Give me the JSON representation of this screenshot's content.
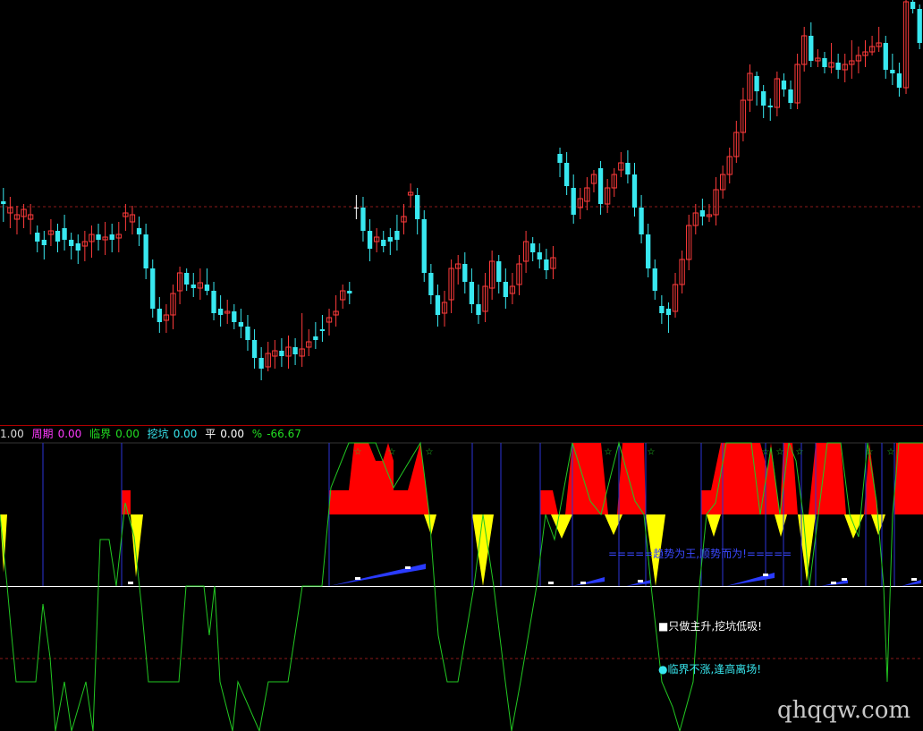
{
  "colors": {
    "up": "#ff3b3b",
    "down": "#38e8f0",
    "flat": "#ffffff",
    "grid": "#8b1a1a",
    "divider": "#b00000",
    "osc": "#22c822",
    "red": "#ff0000",
    "yellow": "#ffff00",
    "blue": "#2a3bff",
    "vline": "#2b34d8",
    "star": "#22c822"
  },
  "legend": {
    "first_value": "1.00",
    "period_label": "周期",
    "period_value": "0.00",
    "critical_label": "临界",
    "critical_value": "0.00",
    "dig_label": "挖坑",
    "dig_value": "0.00",
    "flat_label": "平",
    "flat_value": "0.00",
    "pct_label": "%",
    "pct_value": "-66.67"
  },
  "notes": {
    "trend_banner": "=====趋势为王,顺势而为!=====",
    "note_main": "只做主升,挖坑低吸!",
    "note_critical": "临界不涨,逢高离场!"
  },
  "watermark": "qhqqw.com",
  "candles": [
    [
      225,
      228,
      248,
      210
    ],
    [
      238,
      232,
      255,
      220
    ],
    [
      245,
      240,
      262,
      230
    ],
    [
      242,
      234,
      255,
      228
    ],
    [
      245,
      240,
      262,
      228
    ],
    [
      260,
      270,
      282,
      252
    ],
    [
      268,
      274,
      290,
      258
    ],
    [
      262,
      258,
      275,
      245
    ],
    [
      258,
      270,
      282,
      250
    ],
    [
      255,
      268,
      280,
      240
    ],
    [
      268,
      275,
      290,
      260
    ],
    [
      272,
      280,
      295,
      262
    ],
    [
      275,
      270,
      292,
      258
    ],
    [
      270,
      262,
      288,
      252
    ],
    [
      262,
      268,
      280,
      250
    ],
    [
      268,
      265,
      285,
      248
    ],
    [
      262,
      268,
      282,
      250
    ],
    [
      266,
      262,
      282,
      248
    ],
    [
      242,
      238,
      258,
      228
    ],
    [
      248,
      240,
      262,
      230
    ],
    [
      255,
      262,
      275,
      242
    ],
    [
      262,
      300,
      312,
      250
    ],
    [
      300,
      345,
      355,
      290
    ],
    [
      345,
      360,
      372,
      332
    ],
    [
      358,
      352,
      372,
      340
    ],
    [
      352,
      328,
      368,
      318
    ],
    [
      325,
      305,
      340,
      298
    ],
    [
      305,
      318,
      325,
      300
    ],
    [
      318,
      322,
      332,
      305
    ],
    [
      322,
      316,
      335,
      300
    ],
    [
      318,
      325,
      330,
      300
    ],
    [
      325,
      350,
      358,
      315
    ],
    [
      345,
      352,
      365,
      330
    ],
    [
      350,
      348,
      362,
      335
    ],
    [
      348,
      360,
      368,
      340
    ],
    [
      360,
      365,
      378,
      345
    ],
    [
      365,
      380,
      392,
      352
    ],
    [
      380,
      400,
      412,
      368
    ],
    [
      400,
      412,
      425,
      388
    ],
    [
      410,
      395,
      415,
      382
    ],
    [
      398,
      392,
      412,
      380
    ],
    [
      392,
      398,
      410,
      378
    ],
    [
      398,
      388,
      412,
      375
    ],
    [
      388,
      396,
      408,
      378
    ],
    [
      398,
      390,
      410,
      350
    ],
    [
      388,
      382,
      398,
      368
    ],
    [
      376,
      380,
      390,
      360
    ],
    [
      368,
      370,
      382,
      352
    ],
    [
      360,
      355,
      375,
      345
    ],
    [
      352,
      348,
      365,
      330
    ],
    [
      335,
      325,
      345,
      318
    ],
    [
      325,
      328,
      340,
      315
    ],
    [
      232,
      232,
      245,
      218
    ],
    [
      232,
      258,
      270,
      220
    ],
    [
      258,
      278,
      292,
      245
    ],
    [
      270,
      265,
      282,
      255
    ],
    [
      268,
      275,
      282,
      258
    ],
    [
      265,
      270,
      285,
      255
    ],
    [
      258,
      268,
      280,
      240
    ],
    [
      248,
      242,
      262,
      228
    ],
    [
      218,
      215,
      232,
      205
    ],
    [
      218,
      245,
      262,
      210
    ],
    [
      245,
      305,
      315,
      235
    ],
    [
      305,
      330,
      340,
      295
    ],
    [
      330,
      352,
      365,
      318
    ],
    [
      350,
      338,
      365,
      325
    ],
    [
      335,
      300,
      350,
      290
    ],
    [
      300,
      295,
      318,
      285
    ],
    [
      295,
      315,
      328,
      282
    ],
    [
      315,
      340,
      350,
      300
    ],
    [
      340,
      352,
      362,
      318
    ],
    [
      348,
      320,
      360,
      305
    ],
    [
      322,
      292,
      335,
      280
    ],
    [
      292,
      315,
      328,
      285
    ],
    [
      315,
      332,
      345,
      300
    ],
    [
      328,
      320,
      340,
      305
    ],
    [
      318,
      295,
      330,
      285
    ],
    [
      292,
      270,
      305,
      258
    ],
    [
      272,
      282,
      292,
      265
    ],
    [
      282,
      290,
      300,
      272
    ],
    [
      290,
      302,
      312,
      278
    ],
    [
      300,
      288,
      312,
      275
    ],
    [
      172,
      182,
      198,
      165
    ],
    [
      182,
      208,
      218,
      170
    ],
    [
      210,
      240,
      250,
      195
    ],
    [
      232,
      222,
      245,
      210
    ],
    [
      225,
      210,
      235,
      198
    ],
    [
      205,
      195,
      215,
      190
    ],
    [
      188,
      228,
      240,
      180
    ],
    [
      228,
      210,
      238,
      200
    ],
    [
      210,
      195,
      220,
      188
    ],
    [
      190,
      182,
      198,
      170
    ],
    [
      182,
      195,
      205,
      168
    ],
    [
      195,
      232,
      242,
      182
    ],
    [
      232,
      262,
      272,
      218
    ],
    [
      262,
      300,
      310,
      250
    ],
    [
      300,
      325,
      335,
      290
    ],
    [
      342,
      350,
      362,
      330
    ],
    [
      345,
      352,
      372,
      338
    ],
    [
      348,
      318,
      355,
      305
    ],
    [
      318,
      290,
      328,
      280
    ],
    [
      290,
      252,
      302,
      240
    ],
    [
      252,
      238,
      262,
      228
    ],
    [
      235,
      242,
      252,
      222
    ],
    [
      242,
      240,
      248,
      228
    ],
    [
      240,
      212,
      252,
      198
    ],
    [
      212,
      195,
      222,
      185
    ],
    [
      195,
      175,
      205,
      165
    ],
    [
      175,
      148,
      182,
      135
    ],
    [
      148,
      112,
      158,
      98
    ],
    [
      112,
      82,
      125,
      72
    ],
    [
      85,
      102,
      118,
      80
    ],
    [
      102,
      118,
      132,
      95
    ],
    [
      118,
      120,
      135,
      110
    ],
    [
      120,
      88,
      130,
      80
    ],
    [
      90,
      100,
      108,
      82
    ],
    [
      100,
      115,
      122,
      90
    ],
    [
      115,
      72,
      122,
      60
    ],
    [
      72,
      40,
      80,
      30
    ],
    [
      40,
      68,
      75,
      25
    ],
    [
      68,
      65,
      75,
      55
    ],
    [
      65,
      75,
      82,
      58
    ],
    [
      75,
      70,
      82,
      48
    ],
    [
      70,
      78,
      88,
      60
    ],
    [
      78,
      72,
      92,
      60
    ],
    [
      72,
      68,
      88,
      45
    ],
    [
      68,
      62,
      82,
      52
    ],
    [
      62,
      58,
      75,
      45
    ],
    [
      58,
      52,
      62,
      40
    ],
    [
      52,
      48,
      58,
      30
    ],
    [
      48,
      78,
      88,
      40
    ],
    [
      78,
      82,
      95,
      60
    ],
    [
      82,
      98,
      108,
      70
    ],
    [
      98,
      2,
      105,
      0
    ],
    [
      2,
      10,
      15,
      0
    ],
    [
      10,
      48,
      55,
      5
    ]
  ],
  "osc": [
    [
      0,
      575
    ],
    [
      8,
      655
    ],
    [
      12,
      700
    ],
    [
      18,
      762
    ],
    [
      40,
      762
    ],
    [
      48,
      675
    ],
    [
      56,
      735
    ],
    [
      62,
      817
    ],
    [
      72,
      762
    ],
    [
      80,
      817
    ],
    [
      96,
      762
    ],
    [
      104,
      817
    ],
    [
      112,
      603
    ],
    [
      122,
      603
    ],
    [
      130,
      655
    ],
    [
      140,
      562
    ],
    [
      150,
      600
    ],
    [
      158,
      675
    ],
    [
      166,
      762
    ],
    [
      200,
      762
    ],
    [
      208,
      655
    ],
    [
      228,
      655
    ],
    [
      234,
      710
    ],
    [
      240,
      655
    ],
    [
      246,
      762
    ],
    [
      260,
      817
    ],
    [
      266,
      762
    ],
    [
      290,
      817
    ],
    [
      300,
      762
    ],
    [
      322,
      762
    ],
    [
      338,
      655
    ],
    [
      360,
      655
    ],
    [
      370,
      545
    ],
    [
      390,
      495
    ],
    [
      420,
      495
    ],
    [
      440,
      545
    ],
    [
      470,
      495
    ],
    [
      480,
      575
    ],
    [
      490,
      710
    ],
    [
      500,
      762
    ],
    [
      512,
      762
    ],
    [
      530,
      655
    ],
    [
      540,
      575
    ],
    [
      552,
      655
    ],
    [
      565,
      762
    ],
    [
      572,
      817
    ],
    [
      582,
      762
    ],
    [
      600,
      655
    ],
    [
      610,
      575
    ],
    [
      620,
      603
    ],
    [
      640,
      495
    ],
    [
      660,
      560
    ],
    [
      672,
      575
    ],
    [
      692,
      495
    ],
    [
      710,
      560
    ],
    [
      720,
      575
    ],
    [
      728,
      655
    ],
    [
      740,
      762
    ],
    [
      752,
      790
    ],
    [
      760,
      817
    ],
    [
      775,
      762
    ],
    [
      782,
      655
    ],
    [
      790,
      575
    ],
    [
      800,
      562
    ],
    [
      812,
      495
    ],
    [
      840,
      495
    ],
    [
      850,
      575
    ],
    [
      862,
      500
    ],
    [
      872,
      575
    ],
    [
      882,
      495
    ],
    [
      890,
      515
    ],
    [
      898,
      575
    ],
    [
      905,
      655
    ],
    [
      915,
      575
    ],
    [
      925,
      495
    ],
    [
      940,
      495
    ],
    [
      950,
      575
    ],
    [
      960,
      600
    ],
    [
      970,
      495
    ],
    [
      980,
      560
    ],
    [
      988,
      655
    ],
    [
      992,
      762
    ],
    [
      998,
      575
    ],
    [
      1005,
      495
    ],
    [
      1032,
      495
    ]
  ],
  "red_blocks": [
    [
      [
        136,
        575
      ],
      [
        136,
        548
      ],
      [
        146,
        548
      ],
      [
        146,
        575
      ]
    ],
    [
      [
        368,
        575
      ],
      [
        368,
        548
      ],
      [
        390,
        548
      ],
      [
        396,
        495
      ],
      [
        412,
        495
      ],
      [
        420,
        515
      ],
      [
        428,
        515
      ],
      [
        434,
        495
      ],
      [
        440,
        515
      ],
      [
        440,
        548
      ],
      [
        456,
        548
      ],
      [
        470,
        495
      ],
      [
        480,
        575
      ]
    ],
    [
      [
        604,
        575
      ],
      [
        604,
        548
      ],
      [
        618,
        548
      ],
      [
        624,
        575
      ],
      [
        632,
        575
      ],
      [
        640,
        495
      ],
      [
        672,
        495
      ],
      [
        680,
        575
      ],
      [
        690,
        575
      ],
      [
        696,
        495
      ],
      [
        720,
        495
      ],
      [
        722,
        575
      ]
    ],
    [
      [
        784,
        575
      ],
      [
        784,
        548
      ],
      [
        795,
        548
      ],
      [
        806,
        495
      ],
      [
        850,
        495
      ],
      [
        858,
        525
      ],
      [
        862,
        495
      ],
      [
        872,
        575
      ],
      [
        876,
        495
      ],
      [
        886,
        495
      ],
      [
        892,
        575
      ],
      [
        904,
        575
      ],
      [
        912,
        495
      ],
      [
        940,
        495
      ],
      [
        946,
        575
      ],
      [
        966,
        575
      ],
      [
        972,
        495
      ],
      [
        982,
        575
      ],
      [
        1000,
        575
      ],
      [
        1002,
        495
      ],
      [
        1032,
        495
      ],
      [
        1032,
        575
      ]
    ]
  ],
  "yellow_blocks": [
    [
      [
        0,
        575
      ],
      [
        8,
        575
      ],
      [
        4,
        640
      ]
    ],
    [
      [
        146,
        575
      ],
      [
        160,
        575
      ],
      [
        152,
        645
      ]
    ],
    [
      [
        474,
        575
      ],
      [
        488,
        575
      ],
      [
        482,
        598
      ]
    ],
    [
      [
        528,
        575
      ],
      [
        552,
        575
      ],
      [
        540,
        655
      ]
    ],
    [
      [
        616,
        575
      ],
      [
        640,
        575
      ],
      [
        628,
        602
      ]
    ],
    [
      [
        676,
        575
      ],
      [
        696,
        575
      ],
      [
        686,
        598
      ]
    ],
    [
      [
        722,
        575
      ],
      [
        744,
        575
      ],
      [
        733,
        655
      ]
    ],
    [
      [
        790,
        575
      ],
      [
        806,
        575
      ],
      [
        798,
        600
      ]
    ],
    [
      [
        866,
        575
      ],
      [
        880,
        575
      ],
      [
        873,
        600
      ]
    ],
    [
      [
        892,
        575
      ],
      [
        912,
        575
      ],
      [
        902,
        650
      ]
    ],
    [
      [
        944,
        575
      ],
      [
        966,
        575
      ],
      [
        954,
        602
      ]
    ],
    [
      [
        974,
        575
      ],
      [
        990,
        575
      ],
      [
        982,
        598
      ]
    ]
  ],
  "vlines": [
    48,
    136,
    368,
    528,
    560,
    604,
    640,
    692,
    722,
    784,
    808,
    856,
    876,
    896,
    912,
    968,
    986,
    1000
  ],
  "stars": [
    400,
    438,
    480,
    680,
    728,
    856,
    872,
    894,
    972,
    996
  ],
  "blue_ramps": [
    [
      [
        368,
        655
      ],
      [
        476,
        630
      ],
      [
        476,
        636
      ],
      [
        368,
        655
      ]
    ],
    [
      [
        640,
        655
      ],
      [
        676,
        645
      ],
      [
        676,
        650
      ],
      [
        640,
        655
      ]
    ],
    [
      [
        700,
        655
      ],
      [
        728,
        648
      ],
      [
        728,
        652
      ],
      [
        700,
        655
      ]
    ],
    [
      [
        812,
        655
      ],
      [
        866,
        640
      ],
      [
        866,
        646
      ],
      [
        812,
        655
      ]
    ],
    [
      [
        918,
        655
      ],
      [
        948,
        648
      ],
      [
        948,
        652
      ],
      [
        918,
        655
      ]
    ],
    [
      [
        1008,
        655
      ],
      [
        1030,
        648
      ],
      [
        1030,
        652
      ],
      [
        1008,
        655
      ]
    ]
  ],
  "white_ticks": [
    [
      146,
      652
    ],
    [
      400,
      647
    ],
    [
      456,
      635
    ],
    [
      616,
      652
    ],
    [
      652,
      652
    ],
    [
      716,
      650
    ],
    [
      856,
      643
    ],
    [
      932,
      652
    ],
    [
      944,
      648
    ],
    [
      1022,
      648
    ]
  ]
}
